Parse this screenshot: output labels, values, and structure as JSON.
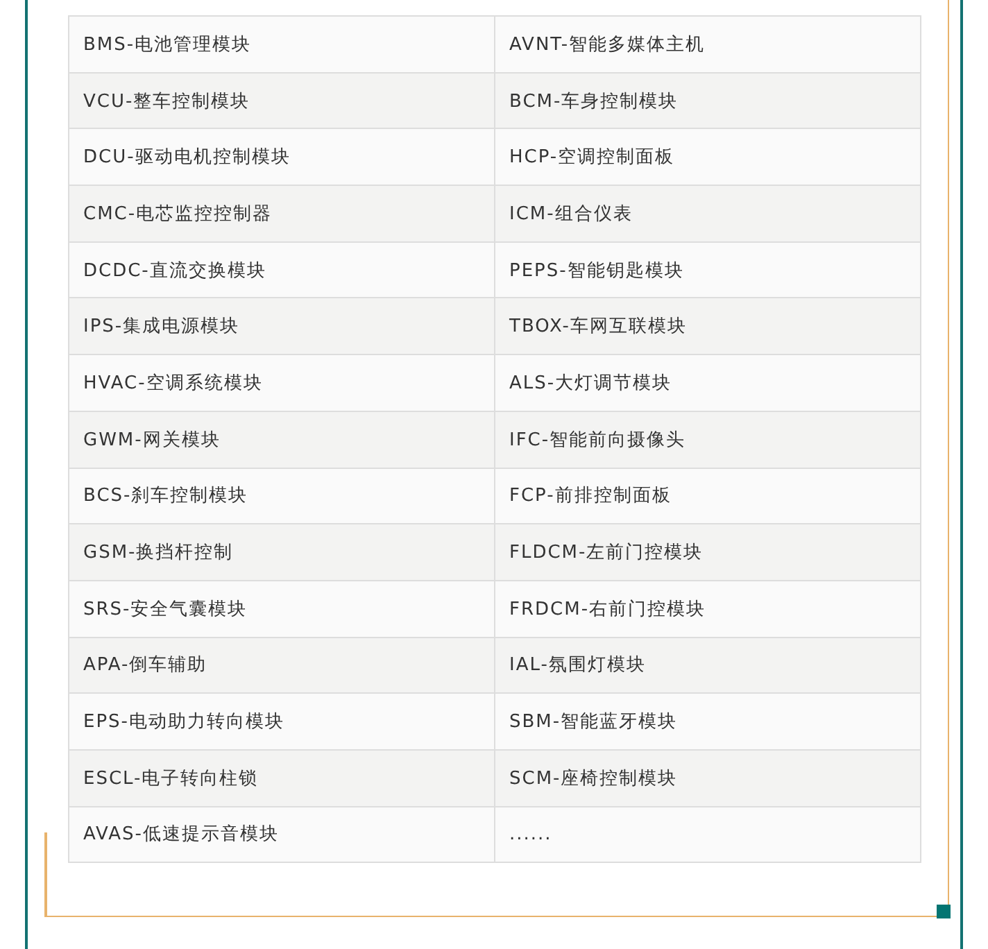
{
  "table": {
    "rows": [
      [
        "BMS-电池管理模块",
        "AVNT-智能多媒体主机"
      ],
      [
        "VCU-整车控制模块",
        "BCM-车身控制模块"
      ],
      [
        "DCU-驱动电机控制模块",
        "HCP-空调控制面板"
      ],
      [
        "CMC-电芯监控控制器",
        "ICM-组合仪表"
      ],
      [
        "DCDC-直流交换模块",
        "PEPS-智能钥匙模块"
      ],
      [
        "IPS-集成电源模块",
        "TBOX-车网互联模块"
      ],
      [
        "HVAC-空调系统模块",
        "ALS-大灯调节模块"
      ],
      [
        "GWM-网关模块",
        "IFC-智能前向摄像头"
      ],
      [
        "BCS-刹车控制模块",
        "FCP-前排控制面板"
      ],
      [
        "GSM-换挡杆控制",
        "FLDCM-左前门控模块"
      ],
      [
        "SRS-安全气囊模块",
        "FRDCM-右前门控模块"
      ],
      [
        "APA-倒车辅助",
        "IAL-氛围灯模块"
      ],
      [
        "EPS-电动助力转向模块",
        "SBM-智能蓝牙模块"
      ],
      [
        "ESCL-电子转向柱锁",
        "SCM-座椅控制模块"
      ],
      [
        "AVAS-低速提示音模块",
        "......"
      ]
    ]
  }
}
